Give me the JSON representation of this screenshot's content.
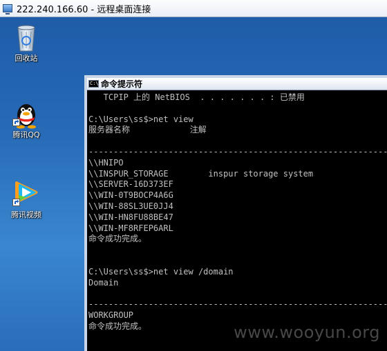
{
  "window": {
    "title": "222.240.166.60 - 远程桌面连接"
  },
  "desktop": {
    "icons": [
      {
        "label": "回收站",
        "icon": "recycle-bin-icon"
      },
      {
        "label": "腾讯QQ",
        "icon": "qq-penguin-icon"
      },
      {
        "label": "腾讯视频",
        "icon": "tencent-video-icon"
      }
    ]
  },
  "cmd": {
    "title": "命令提示符",
    "icon_text": "C:\\",
    "lines": [
      "   TCPIP 上的 NetBIOS  . . . . . . . : 已禁用",
      "",
      "C:\\Users\\ss$>net view",
      "服务器名称            注解",
      "",
      "---------------------------------------------------------------------",
      "\\\\HNIPO",
      "\\\\INSPUR_STORAGE        inspur storage system",
      "\\\\SERVER-16D373EF",
      "\\\\WIN-0T9BOCP4A6G",
      "\\\\WIN-88SL3UE0JJ4",
      "\\\\WIN-HN8FU88BE47",
      "\\\\WIN-MF8RFEP6ARL",
      "命令成功完成。",
      "",
      "",
      "C:\\Users\\ss$>net view /domain",
      "Domain",
      "",
      "---------------------------------------------------------------------",
      "WORKGROUP",
      "命令成功完成。"
    ]
  },
  "watermark": "www.wooyun.org",
  "colors": {
    "desktop_blue": "#2669b5",
    "console_bg": "#000000",
    "console_text": "#c0c0c0"
  }
}
